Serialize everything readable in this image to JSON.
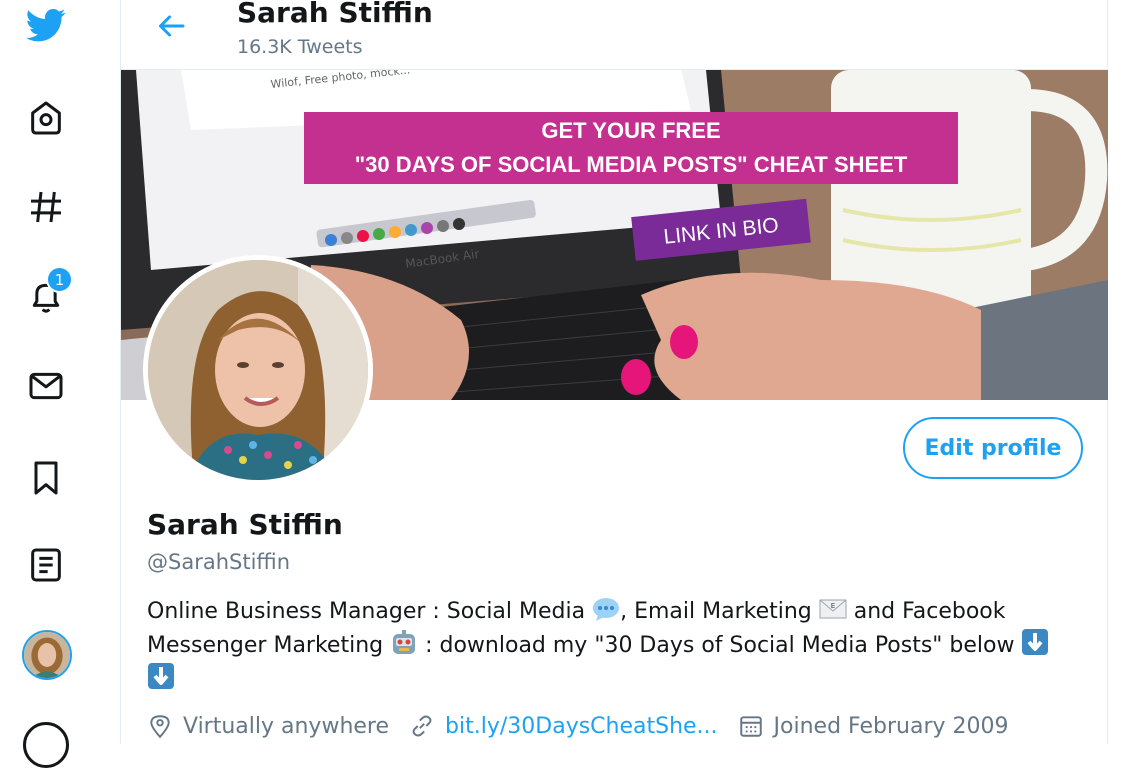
{
  "header": {
    "name": "Sarah Stiffin",
    "tweets_count": "16.3K Tweets"
  },
  "banner": {
    "line1": "GET YOUR FREE",
    "line2": "\"30 DAYS OF SOCIAL MEDIA POSTS\" CHEAT SHEET",
    "tag": "LINK IN BIO",
    "laptop_label": "MacBook Air",
    "browser_text": "Wilof, Free photo, mock..."
  },
  "sidebar": {
    "items": [
      "twitter-logo",
      "home",
      "explore",
      "notifications",
      "messages",
      "bookmarks",
      "lists",
      "profile",
      "more"
    ],
    "notification_badge": "1"
  },
  "profile": {
    "name": "Sarah Stiffin",
    "handle": "@SarahStiffin",
    "edit_button": "Edit profile",
    "bio": {
      "part1": "Online Business Manager : Social Media ",
      "part2": ", Email Marketing ",
      "part3": " and Facebook Messenger Marketing ",
      "part4": " : download my \"30 Days of Social Media Posts\" below "
    },
    "location": "Virtually anywhere",
    "website": "bit.ly/30DaysCheatShe...",
    "joined": "Joined February 2009"
  },
  "colors": {
    "accent": "#1da1f2",
    "text": "#14171a",
    "secondary": "#657786",
    "banner_pink": "#c4308f",
    "banner_purple": "#7a2b97"
  }
}
